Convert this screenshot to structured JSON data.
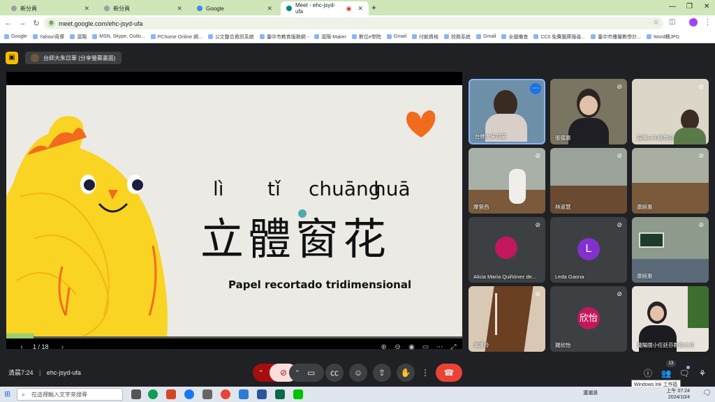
{
  "browser": {
    "tabs": [
      {
        "title": "新分頁"
      },
      {
        "title": "新分頁"
      },
      {
        "title": "Google"
      },
      {
        "title": "Meet - ehc-jsyd-ufa"
      }
    ],
    "url": "meet.google.com/ehc-jsyd-ufa",
    "bookmarks": [
      "Google",
      "Yahoo!奇摩",
      "滬陽",
      "MSN, Skype, Outlo...",
      "PChome Online 網...",
      "公文整合資訊系統",
      "臺中市教育服務網 -",
      "滬陽-Maker",
      "數位e學院",
      "Gmail",
      "付款資格",
      "校務系統",
      "Gmail",
      "全國備查",
      "CC0 免費圖庫搜尋...",
      "臺中市樓層數學計...",
      "Word轉JPG"
    ]
  },
  "meet": {
    "presenter": "台師大朱苡華 (分享螢幕畫面)",
    "slide": {
      "pinyin": [
        "lì",
        "tǐ",
        "chuāng",
        "huā"
      ],
      "hanzi": "立體窗花",
      "subtitle": "Papel recortado tridimensional",
      "page": "1 / 18"
    },
    "tiles": [
      {
        "name": "台師大朱苡華"
      },
      {
        "name": "張德惠"
      },
      {
        "name": "霧峰三年級教室"
      },
      {
        "name": "摩登西"
      },
      {
        "name": "林淑慧"
      },
      {
        "name": "康婉惠"
      },
      {
        "name": "Alicia María Quiñónez de..."
      },
      {
        "name": "Leda Gaona",
        "initial": "L"
      },
      {
        "name": "康婉惠"
      },
      {
        "name": "溝惠玲"
      },
      {
        "name": "擺欣怡",
        "initial": "欣怡"
      },
      {
        "name": "瀧陽國小任廷芬教務主任"
      }
    ],
    "meeting_time": "清晨7:24",
    "meeting_code": "ehc-jsyd-ufa",
    "participants_badge": "13",
    "tooltip": "Windows Ink 工作區"
  },
  "taskbar": {
    "search_placeholder": "在這裡輸入文字來搜尋",
    "weather": "濃潮濕",
    "time": "上午 07:24",
    "date": "2024/10/4"
  },
  "colors": {
    "meet_bg": "#202124",
    "end_call": "#ea4335",
    "mic_off": "#a50e0e",
    "chick_yellow": "#f9d423",
    "heart_orange": "#f26b1d",
    "avatar_purple": "#8430ce",
    "avatar_pink": "#c2185b"
  }
}
